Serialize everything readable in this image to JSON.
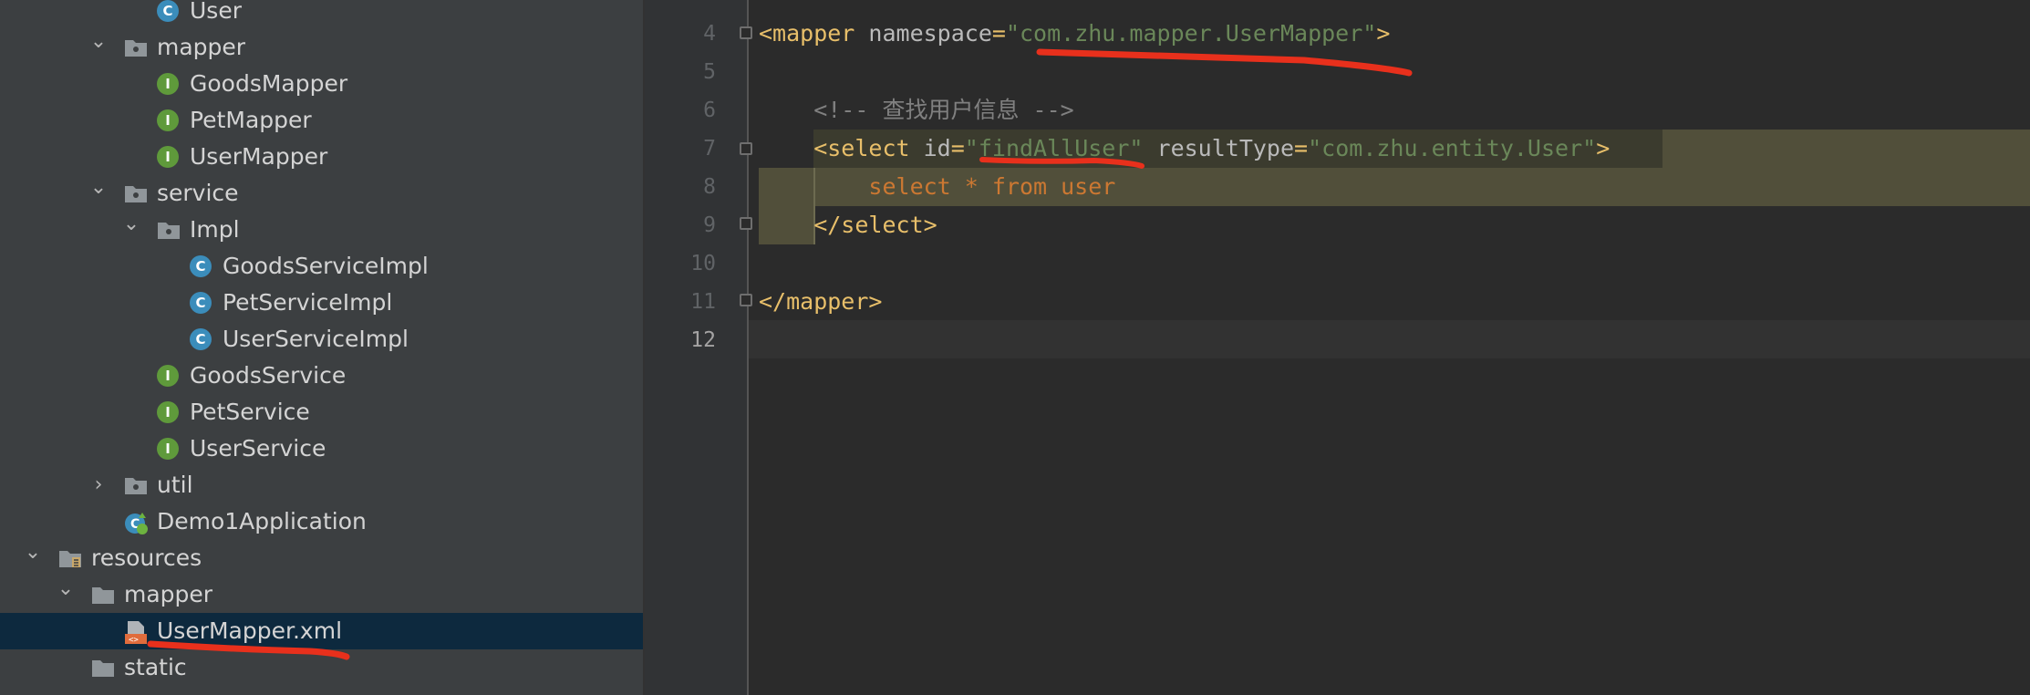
{
  "project_tree": {
    "items": [
      {
        "label": "User",
        "icon": "class-icon",
        "badge": "C",
        "arrow": ""
      },
      {
        "label": "mapper",
        "icon": "package-icon",
        "badge": "",
        "arrow": "expanded"
      },
      {
        "label": "GoodsMapper",
        "icon": "interface-icon",
        "badge": "I",
        "arrow": ""
      },
      {
        "label": "PetMapper",
        "icon": "interface-icon",
        "badge": "I",
        "arrow": ""
      },
      {
        "label": "UserMapper",
        "icon": "interface-icon",
        "badge": "I",
        "arrow": ""
      },
      {
        "label": "service",
        "icon": "package-icon",
        "badge": "",
        "arrow": "expanded"
      },
      {
        "label": "Impl",
        "icon": "package-icon",
        "badge": "",
        "arrow": "expanded"
      },
      {
        "label": "GoodsServiceImpl",
        "icon": "class-icon",
        "badge": "C",
        "arrow": ""
      },
      {
        "label": "PetServiceImpl",
        "icon": "class-icon",
        "badge": "C",
        "arrow": ""
      },
      {
        "label": "UserServiceImpl",
        "icon": "class-icon",
        "badge": "C",
        "arrow": ""
      },
      {
        "label": "GoodsService",
        "icon": "interface-icon",
        "badge": "I",
        "arrow": ""
      },
      {
        "label": "PetService",
        "icon": "interface-icon",
        "badge": "I",
        "arrow": ""
      },
      {
        "label": "UserService",
        "icon": "interface-icon",
        "badge": "I",
        "arrow": ""
      },
      {
        "label": "util",
        "icon": "package-icon",
        "badge": "",
        "arrow": "collapsed"
      },
      {
        "label": "Demo1Application",
        "icon": "spring-boot-class-icon",
        "badge": "",
        "arrow": ""
      },
      {
        "label": "resources",
        "icon": "resources-folder-icon",
        "badge": "",
        "arrow": "expanded"
      },
      {
        "label": "mapper",
        "icon": "folder-icon",
        "badge": "",
        "arrow": "expanded"
      },
      {
        "label": "UserMapper.xml",
        "icon": "xml-file-icon",
        "badge": "",
        "arrow": "",
        "selected": true
      },
      {
        "label": "static",
        "icon": "folder-icon",
        "badge": "",
        "arrow": ""
      }
    ]
  },
  "editor": {
    "line_numbers": [
      "4",
      "5",
      "6",
      "7",
      "8",
      "9",
      "10",
      "11",
      "12"
    ],
    "current_line": "12",
    "lines": [
      {
        "num": "4",
        "tokens": [
          [
            "tag",
            "<mapper "
          ],
          [
            "attr",
            "namespace"
          ],
          [
            "tag",
            "="
          ],
          [
            "val",
            "\"com.zhu.mapper.UserMapper\""
          ],
          [
            "tag",
            ">"
          ]
        ]
      },
      {
        "num": "5",
        "tokens": []
      },
      {
        "num": "6",
        "tokens": [
          [
            "cmt",
            "    <!-- 查找用户信息 -->"
          ]
        ]
      },
      {
        "num": "7",
        "tokens": [
          [
            "tag",
            "    <select "
          ],
          [
            "attr",
            "id"
          ],
          [
            "tag",
            "="
          ],
          [
            "val",
            "\"findAllUser\""
          ],
          [
            "attr",
            " resultType"
          ],
          [
            "tag",
            "="
          ],
          [
            "val",
            "\"com.zhu.entity.User\""
          ],
          [
            "tag",
            ">"
          ]
        ]
      },
      {
        "num": "8",
        "tokens": [
          [
            "sql",
            "        select * from user"
          ]
        ]
      },
      {
        "num": "9",
        "tokens": [
          [
            "tag",
            "    </select>"
          ]
        ]
      },
      {
        "num": "10",
        "tokens": []
      },
      {
        "num": "11",
        "tokens": [
          [
            "tag",
            "</mapper>"
          ]
        ]
      },
      {
        "num": "12",
        "tokens": []
      }
    ]
  },
  "colors": {
    "annotation_red": "#e8301c",
    "selection_blue": "#0d293e",
    "string_green": "#6a8759",
    "tag_yellow": "#e8bf6a"
  }
}
